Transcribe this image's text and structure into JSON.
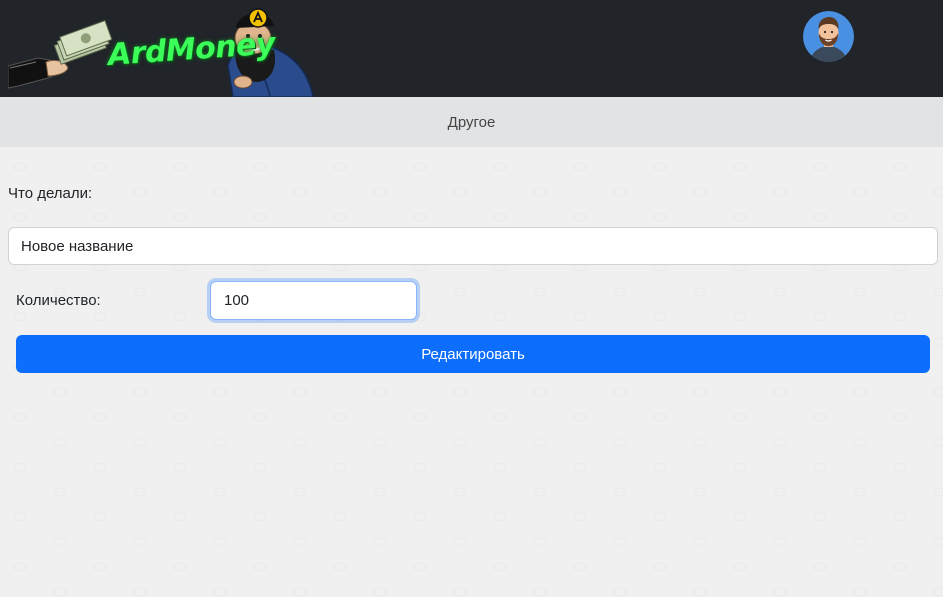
{
  "header": {
    "logo_text": "ArdMoney",
    "logo_icon": "money-hand-mascot-logo",
    "avatar_icon": "user-avatar-icon"
  },
  "subnav": {
    "title": "Другое"
  },
  "form": {
    "description_label": "Что делали:",
    "description_value": "Новое название",
    "quantity_label": "Количество:",
    "quantity_value": "100",
    "submit_label": "Редактировать"
  },
  "colors": {
    "header_bg": "#212429",
    "subnav_bg": "#e2e3e5",
    "page_bg": "#f0f0f0",
    "primary": "#0d6efd",
    "logo_green": "#3cff5a"
  }
}
